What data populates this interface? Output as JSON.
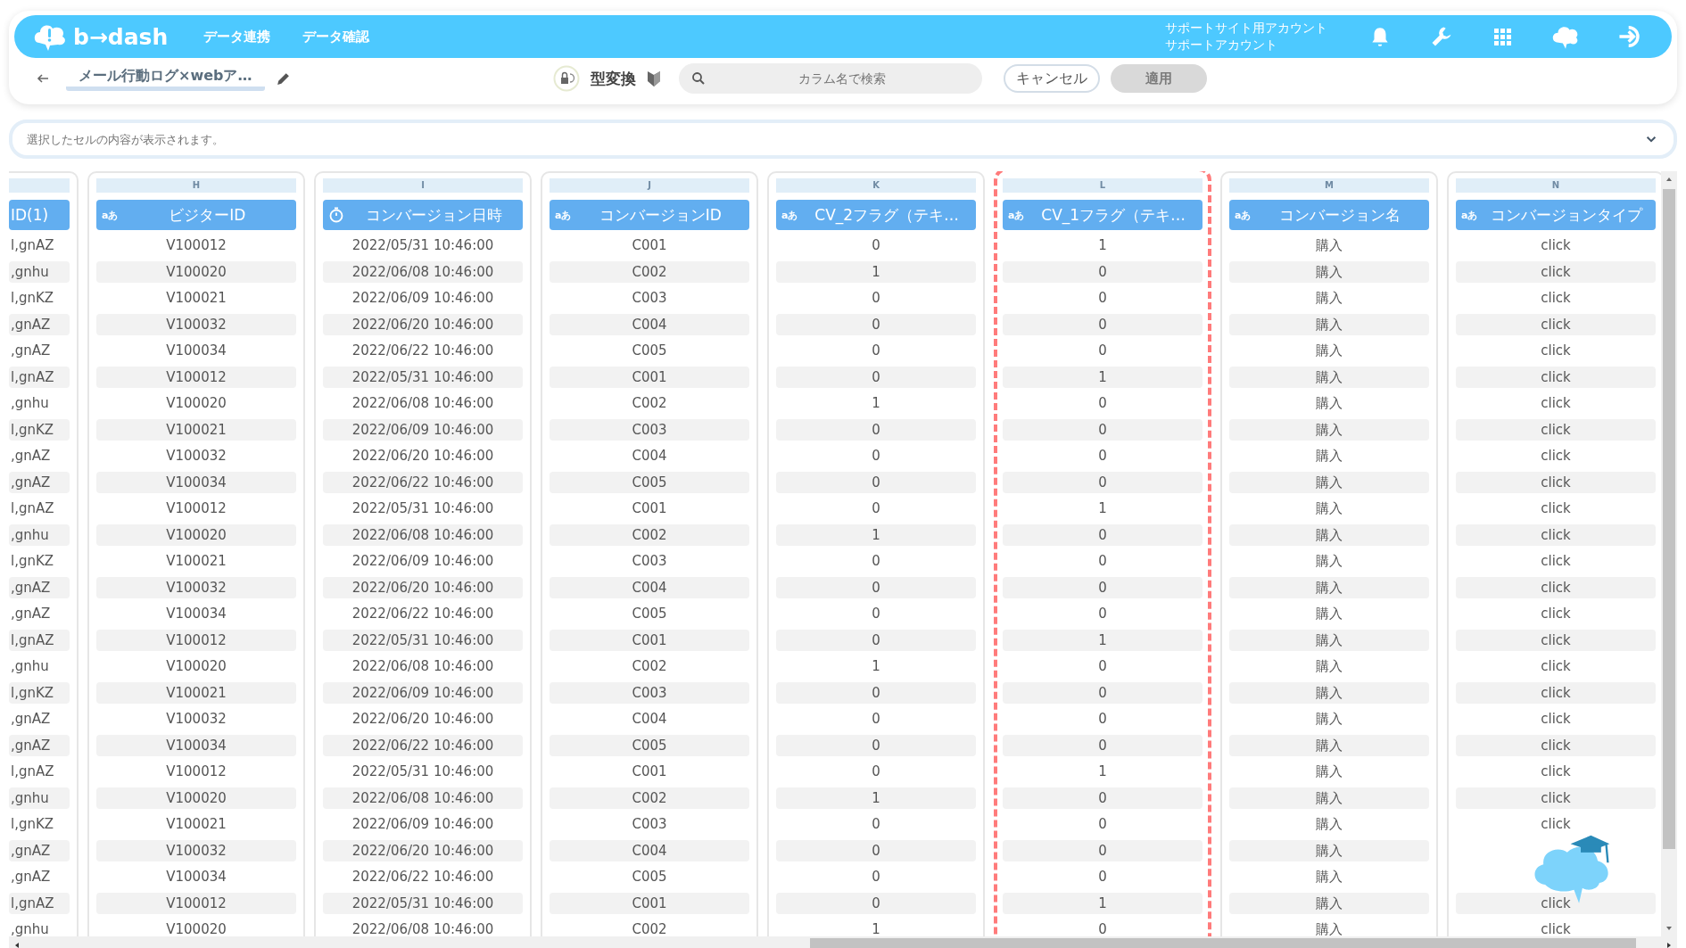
{
  "header": {
    "logo": "b→dash",
    "nav": [
      "データ連携",
      "データ確認"
    ],
    "account": [
      "サポートサイト用アカウント",
      "サポートアカウント"
    ]
  },
  "toolbar": {
    "title": "メール行動ログ×webア…",
    "convert_label": "型変換",
    "search": {
      "placeholder": "カラム名で検索"
    },
    "cancel": "キャンセル",
    "apply": {
      "label": "適用",
      "disabled": true
    }
  },
  "cell_info": {
    "placeholder": "選択したセルの内容が表示されます。"
  },
  "table": {
    "columns": [
      {
        "header": "ID(1)",
        "kind": "plain",
        "selected": false
      },
      {
        "letter": "H",
        "header": "ビジターID",
        "kind": "text",
        "type_icon": "aあ",
        "selected": false
      },
      {
        "letter": "I",
        "header": "コンバージョン日時",
        "kind": "datetime",
        "selected": false
      },
      {
        "letter": "J",
        "header": "コンバージョンID",
        "kind": "text",
        "type_icon": "aあ",
        "selected": false
      },
      {
        "letter": "K",
        "header": "CV_2フラグ（テキ…",
        "kind": "text",
        "type_icon": "aあ",
        "selected": false
      },
      {
        "letter": "L",
        "header": "CV_1フラグ（テキ…",
        "kind": "text",
        "type_icon": "aあ",
        "selected": true
      },
      {
        "letter": "M",
        "header": "コンバージョン名",
        "kind": "text",
        "type_icon": "aあ",
        "selected": false
      },
      {
        "letter": "N",
        "header": "コンバージョンタイプ",
        "kind": "text",
        "type_icon": "aあ",
        "selected": false
      }
    ],
    "rows": [
      [
        "l,gnAZ",
        "V100012",
        "2022/05/31 10:46:00",
        "C001",
        "0",
        "1",
        "購入",
        "click"
      ],
      [
        ",gnhu",
        "V100020",
        "2022/06/08 10:46:00",
        "C002",
        "1",
        "0",
        "購入",
        "click"
      ],
      [
        "l,gnKZ",
        "V100021",
        "2022/06/09 10:46:00",
        "C003",
        "0",
        "0",
        "購入",
        "click"
      ],
      [
        ",gnAZ",
        "V100032",
        "2022/06/20 10:46:00",
        "C004",
        "0",
        "0",
        "購入",
        "click"
      ],
      [
        ",gnAZ",
        "V100034",
        "2022/06/22 10:46:00",
        "C005",
        "0",
        "0",
        "購入",
        "click"
      ],
      [
        "l,gnAZ",
        "V100012",
        "2022/05/31 10:46:00",
        "C001",
        "0",
        "1",
        "購入",
        "click"
      ],
      [
        ",gnhu",
        "V100020",
        "2022/06/08 10:46:00",
        "C002",
        "1",
        "0",
        "購入",
        "click"
      ],
      [
        "l,gnKZ",
        "V100021",
        "2022/06/09 10:46:00",
        "C003",
        "0",
        "0",
        "購入",
        "click"
      ],
      [
        ",gnAZ",
        "V100032",
        "2022/06/20 10:46:00",
        "C004",
        "0",
        "0",
        "購入",
        "click"
      ],
      [
        ",gnAZ",
        "V100034",
        "2022/06/22 10:46:00",
        "C005",
        "0",
        "0",
        "購入",
        "click"
      ],
      [
        "l,gnAZ",
        "V100012",
        "2022/05/31 10:46:00",
        "C001",
        "0",
        "1",
        "購入",
        "click"
      ],
      [
        ",gnhu",
        "V100020",
        "2022/06/08 10:46:00",
        "C002",
        "1",
        "0",
        "購入",
        "click"
      ],
      [
        "l,gnKZ",
        "V100021",
        "2022/06/09 10:46:00",
        "C003",
        "0",
        "0",
        "購入",
        "click"
      ],
      [
        ",gnAZ",
        "V100032",
        "2022/06/20 10:46:00",
        "C004",
        "0",
        "0",
        "購入",
        "click"
      ],
      [
        ",gnAZ",
        "V100034",
        "2022/06/22 10:46:00",
        "C005",
        "0",
        "0",
        "購入",
        "click"
      ],
      [
        "l,gnAZ",
        "V100012",
        "2022/05/31 10:46:00",
        "C001",
        "0",
        "1",
        "購入",
        "click"
      ],
      [
        ",gnhu",
        "V100020",
        "2022/06/08 10:46:00",
        "C002",
        "1",
        "0",
        "購入",
        "click"
      ],
      [
        "l,gnKZ",
        "V100021",
        "2022/06/09 10:46:00",
        "C003",
        "0",
        "0",
        "購入",
        "click"
      ],
      [
        ",gnAZ",
        "V100032",
        "2022/06/20 10:46:00",
        "C004",
        "0",
        "0",
        "購入",
        "click"
      ],
      [
        ",gnAZ",
        "V100034",
        "2022/06/22 10:46:00",
        "C005",
        "0",
        "0",
        "購入",
        "click"
      ],
      [
        "l,gnAZ",
        "V100012",
        "2022/05/31 10:46:00",
        "C001",
        "0",
        "1",
        "購入",
        "click"
      ],
      [
        ",gnhu",
        "V100020",
        "2022/06/08 10:46:00",
        "C002",
        "1",
        "0",
        "購入",
        "click"
      ],
      [
        "l,gnKZ",
        "V100021",
        "2022/06/09 10:46:00",
        "C003",
        "0",
        "0",
        "購入",
        "click"
      ],
      [
        ",gnAZ",
        "V100032",
        "2022/06/20 10:46:00",
        "C004",
        "0",
        "0",
        "購入",
        null
      ],
      [
        ",gnAZ",
        "V100034",
        "2022/06/22 10:46:00",
        "C005",
        "0",
        "0",
        "購入",
        null
      ],
      [
        "l,gnAZ",
        "V100012",
        "2022/05/31 10:46:00",
        "C001",
        "0",
        "1",
        "購入",
        "click"
      ],
      [
        ",gnhu",
        "V100020",
        "2022/06/08 10:46:00",
        "C002",
        "1",
        "0",
        "購入",
        "click"
      ]
    ]
  }
}
